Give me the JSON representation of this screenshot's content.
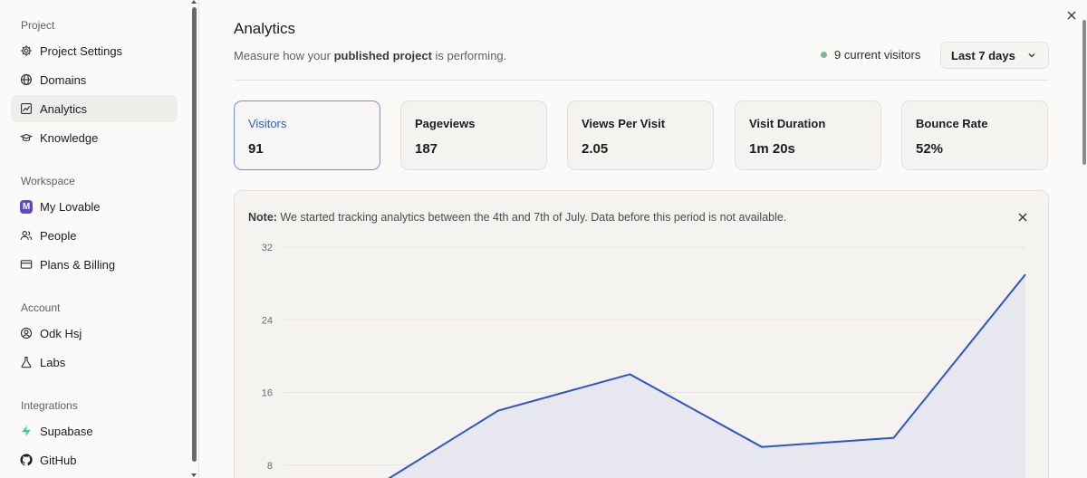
{
  "sidebar": {
    "sections": [
      {
        "label": "Project",
        "items": [
          {
            "label": "Project Settings",
            "icon": "gear-icon"
          },
          {
            "label": "Domains",
            "icon": "globe-icon"
          },
          {
            "label": "Analytics",
            "icon": "analytics-icon",
            "active": true
          },
          {
            "label": "Knowledge",
            "icon": "book-icon"
          }
        ]
      },
      {
        "label": "Workspace",
        "items": [
          {
            "label": "My Lovable",
            "icon": "workspace-badge-icon",
            "badge": "M"
          },
          {
            "label": "People",
            "icon": "people-icon"
          },
          {
            "label": "Plans & Billing",
            "icon": "credit-card-icon"
          }
        ]
      },
      {
        "label": "Account",
        "items": [
          {
            "label": "Odk Hsj",
            "icon": "user-circle-icon"
          },
          {
            "label": "Labs",
            "icon": "flask-icon"
          }
        ]
      },
      {
        "label": "Integrations",
        "items": [
          {
            "label": "Supabase",
            "icon": "supabase-icon"
          },
          {
            "label": "GitHub",
            "icon": "github-icon"
          }
        ]
      }
    ]
  },
  "header": {
    "title": "Analytics",
    "subtitle_pre": "Measure how your ",
    "subtitle_bold": "published project",
    "subtitle_post": " is performing.",
    "current_visitors": "9 current visitors",
    "range": "Last 7 days"
  },
  "stats": [
    {
      "label": "Visitors",
      "value": "91",
      "active": true
    },
    {
      "label": "Pageviews",
      "value": "187"
    },
    {
      "label": "Views Per Visit",
      "value": "2.05"
    },
    {
      "label": "Visit Duration",
      "value": "1m 20s"
    },
    {
      "label": "Bounce Rate",
      "value": "52%"
    }
  ],
  "note": {
    "bold": "Note:",
    "text": " We started tracking analytics between the 4th and 7th of July. Data before this period is not available."
  },
  "colors": {
    "accent": "#2e5dc9",
    "line": "#2c55c8",
    "area": "#e6e7ef",
    "live_dot": "#6dbf8b"
  },
  "chart_data": {
    "type": "area",
    "x": [
      0,
      1,
      2,
      3,
      4,
      5,
      6
    ],
    "values": [
      5,
      5,
      14,
      18,
      10,
      11,
      29
    ],
    "yticks": [
      32,
      24,
      16,
      8
    ],
    "ylim": [
      0,
      32
    ],
    "grid": true
  }
}
